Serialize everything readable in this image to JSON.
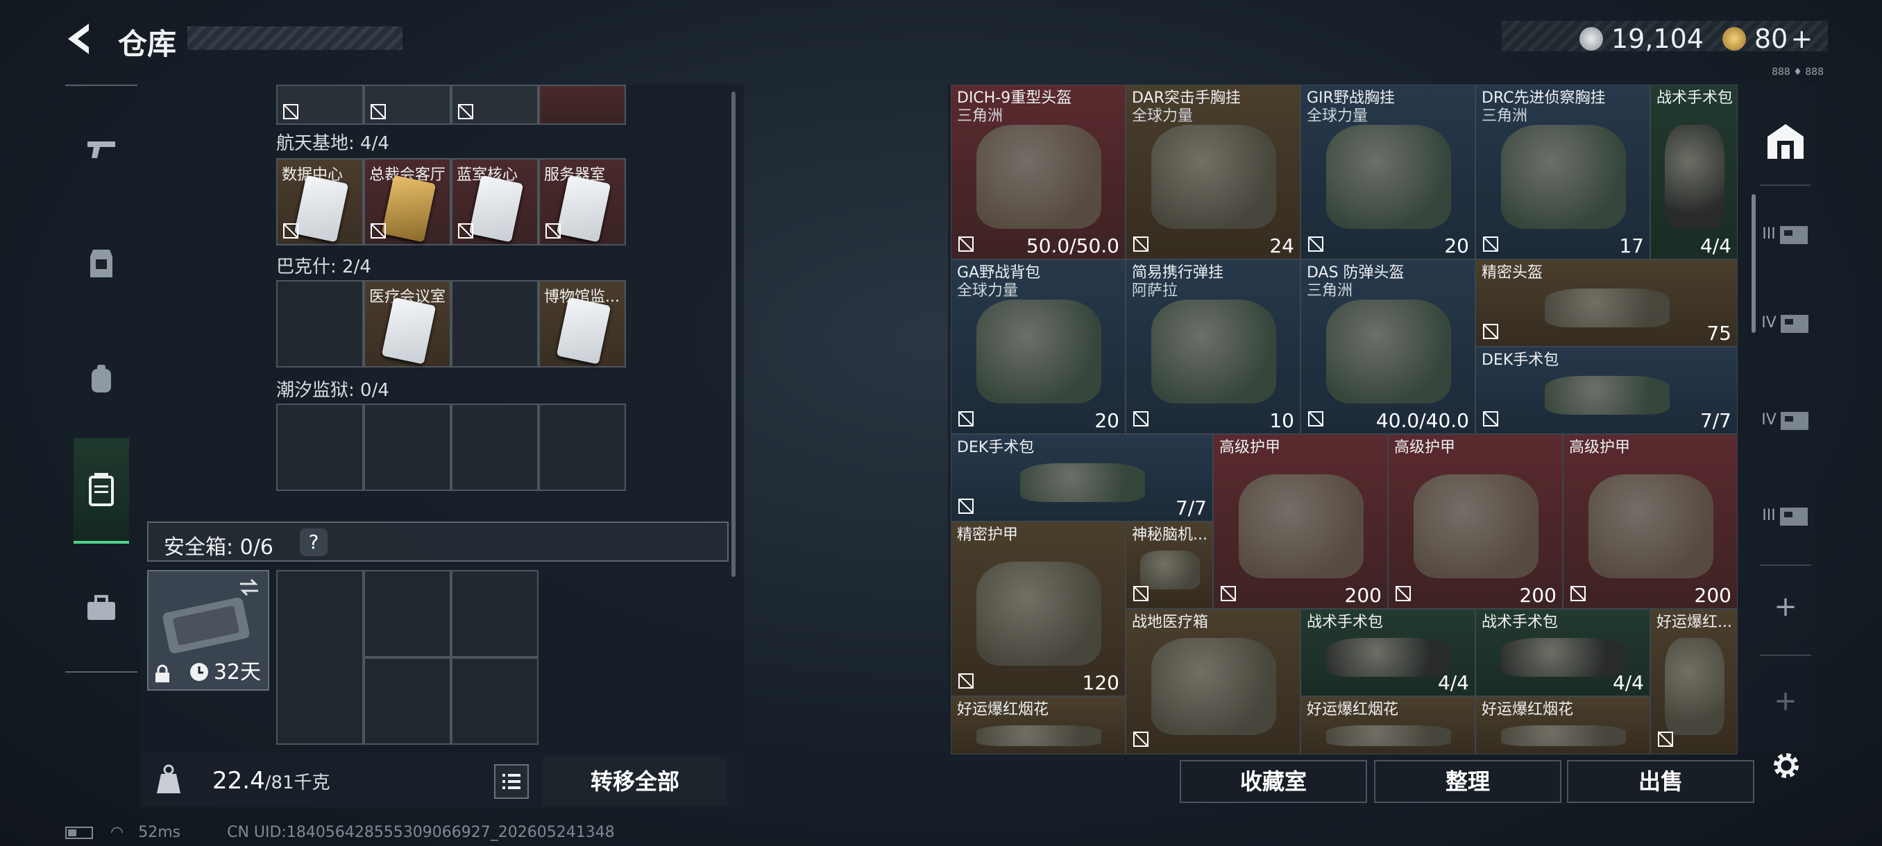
{
  "header": {
    "title": "仓库",
    "coins": "19,104",
    "premium": "80",
    "plus": "+",
    "coin_color": "#c9ccd0",
    "premium_color": "#d9b24a",
    "fps": "888 ♦ 888"
  },
  "left": {
    "groups": [
      {
        "label": "航天基地: 4/4",
        "cells": [
          "数据中心",
          "总裁会客厅",
          "蓝室核心",
          "服务器室"
        ]
      },
      {
        "label": "巴克什: 2/4",
        "cells": [
          "",
          "医疗会议室",
          "",
          "博物馆监..."
        ]
      },
      {
        "label": "潮汐监狱: 0/4",
        "cells": [
          "",
          "",
          "",
          ""
        ]
      }
    ],
    "safe_label": "安全箱: 0/6",
    "safe_help": "?",
    "safe_days": "32天",
    "weight_value": "22.4",
    "weight_max": "/81千克",
    "transfer_all": "转移全部"
  },
  "items": [
    {
      "t1": "DICH-9重型头盔",
      "t2": "三角洲",
      "val": "50.0/50.0",
      "c": "red"
    },
    {
      "t1": "DAR突击手胸挂",
      "t2": "全球力量",
      "val": "24",
      "c": "gold"
    },
    {
      "t1": "GIR野战胸挂",
      "t2": "全球力量",
      "val": "20",
      "c": "blue"
    },
    {
      "t1": "DRC先进侦察胸挂",
      "t2": "三角洲",
      "val": "17",
      "c": "blue"
    },
    {
      "t1": "战术手术包",
      "t2": "",
      "val": "4/4",
      "c": "green"
    },
    {
      "t1": "GA野战背包",
      "t2": "全球力量",
      "val": "20",
      "c": "blue"
    },
    {
      "t1": "简易携行弹挂",
      "t2": "阿萨拉",
      "val": "10",
      "c": "blue"
    },
    {
      "t1": "DAS 防弹头盔",
      "t2": "三角洲",
      "val": "40.0/40.0",
      "c": "blue"
    },
    {
      "t1": "精密头盔",
      "t2": "",
      "val": "75",
      "c": "gold"
    },
    {
      "t1": "DEK手术包",
      "t2": "",
      "val": "7/7",
      "c": "blue"
    },
    {
      "t1": "DEK手术包",
      "t2": "",
      "val": "7/7",
      "c": "blue"
    },
    {
      "t1": "高级护甲",
      "t2": "",
      "val": "200",
      "c": "red"
    },
    {
      "t1": "高级护甲",
      "t2": "",
      "val": "200",
      "c": "red"
    },
    {
      "t1": "高级护甲",
      "t2": "",
      "val": "200",
      "c": "red"
    },
    {
      "t1": "精密护甲",
      "t2": "",
      "val": "120",
      "c": "gold"
    },
    {
      "t1": "神秘脑机...",
      "t2": "",
      "val": "",
      "c": "gold"
    },
    {
      "t1": "战地医疗箱",
      "t2": "",
      "val": "",
      "c": "gold"
    },
    {
      "t1": "战术手术包",
      "t2": "",
      "val": "4/4",
      "c": "green"
    },
    {
      "t1": "战术手术包",
      "t2": "",
      "val": "4/4",
      "c": "green"
    },
    {
      "t1": "好运爆红...",
      "t2": "",
      "val": "",
      "c": "gold"
    },
    {
      "t1": "好运爆红烟花",
      "t2": "",
      "val": "",
      "c": "gold"
    },
    {
      "t1": "好运爆红烟花",
      "t2": "",
      "val": "",
      "c": "gold"
    },
    {
      "t1": "好运爆红烟花",
      "t2": "",
      "val": "",
      "c": "gold"
    }
  ],
  "buttons": {
    "collection": "收藏室",
    "sort": "整理",
    "sell": "出售"
  },
  "right_rail": [
    "III",
    "IV",
    "IV",
    "III",
    "+",
    "+"
  ],
  "status": {
    "ping": "52ms",
    "uid": "CN UID:18405642855530906692​7_202605241348"
  }
}
